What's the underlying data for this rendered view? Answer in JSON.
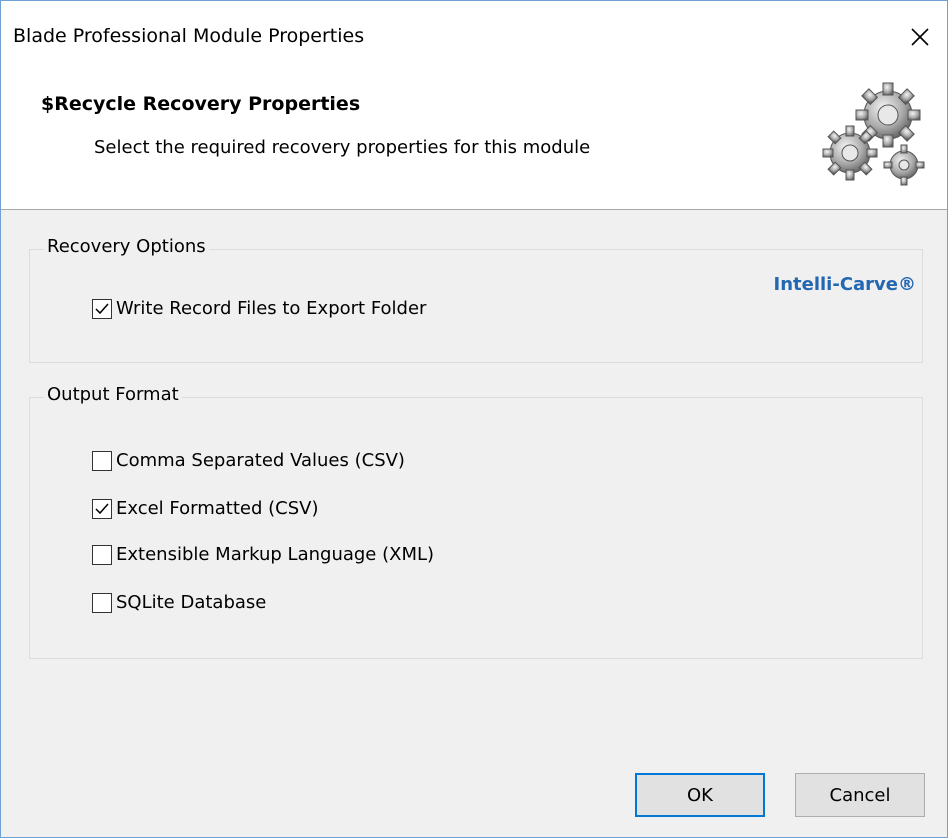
{
  "window": {
    "title": "Blade Professional Module Properties"
  },
  "header": {
    "title": "$Recycle Recovery Properties",
    "subtitle": "Select the required recovery properties for this module",
    "icon": "gears-icon"
  },
  "recovery_options": {
    "legend": "Recovery Options",
    "brand_link": "Intelli-Carve®",
    "items": [
      {
        "label": "Write Record Files to Export Folder",
        "checked": true
      }
    ]
  },
  "output_format": {
    "legend": "Output Format",
    "items": [
      {
        "label": "Comma Separated Values (CSV)",
        "checked": false
      },
      {
        "label": "Excel Formatted (CSV)",
        "checked": true
      },
      {
        "label": "Extensible Markup Language (XML)",
        "checked": false
      },
      {
        "label": "SQLite Database",
        "checked": false
      }
    ]
  },
  "buttons": {
    "ok": "OK",
    "cancel": "Cancel"
  },
  "colors": {
    "accent": "#0078d7",
    "link": "#2366b1",
    "window_border": "#6f9fd3"
  }
}
